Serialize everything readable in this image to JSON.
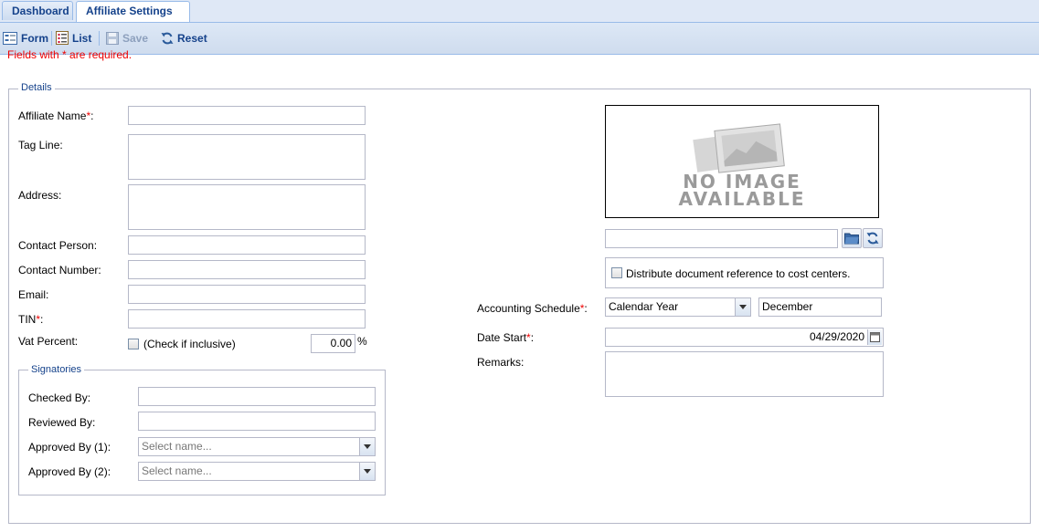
{
  "tabs": [
    {
      "label": "Dashboard"
    },
    {
      "label": "Affiliate Settings",
      "close": "×"
    }
  ],
  "toolbar": {
    "form_label": "Form",
    "list_label": "List",
    "save_label": "Save",
    "reset_label": "Reset"
  },
  "required_note": "Fields with * are required.",
  "details": {
    "legend": "Details",
    "affiliate_name_label": "Affiliate Name",
    "tag_line_label": "Tag Line:",
    "address_label": "Address:",
    "contact_person_label": "Contact Person:",
    "contact_number_label": "Contact Number:",
    "email_label": "Email:",
    "tin_label": "TIN",
    "vat_percent_label": "Vat Percent:",
    "vat_inclusive_label": "(Check if inclusive)",
    "vat_percent_value": "0.00",
    "vat_percent_unit": "%",
    "required_mark": "*",
    "colon": ":"
  },
  "signatories": {
    "legend": "Signatories",
    "checked_by_label": "Checked By:",
    "reviewed_by_label": "Reviewed By:",
    "approved_by_1_label": "Approved By (1):",
    "approved_by_2_label": "Approved By (2):",
    "approved_by_1_placeholder": "Select name...",
    "approved_by_2_placeholder": "Select name..."
  },
  "right": {
    "no_image_line1": "NO IMAGE",
    "no_image_line2": "AVAILABLE",
    "distribute_label": "Distribute document reference to cost centers.",
    "accounting_schedule_label": "Accounting Schedule",
    "accounting_schedule_value": "Calendar Year",
    "month_value": "December",
    "date_start_label": "Date Start",
    "date_start_value": "04/29/2020",
    "remarks_label": "Remarks:"
  },
  "colors": {
    "accent": "#15428b",
    "required": "#ee0000",
    "border": "#b5b8c8"
  }
}
